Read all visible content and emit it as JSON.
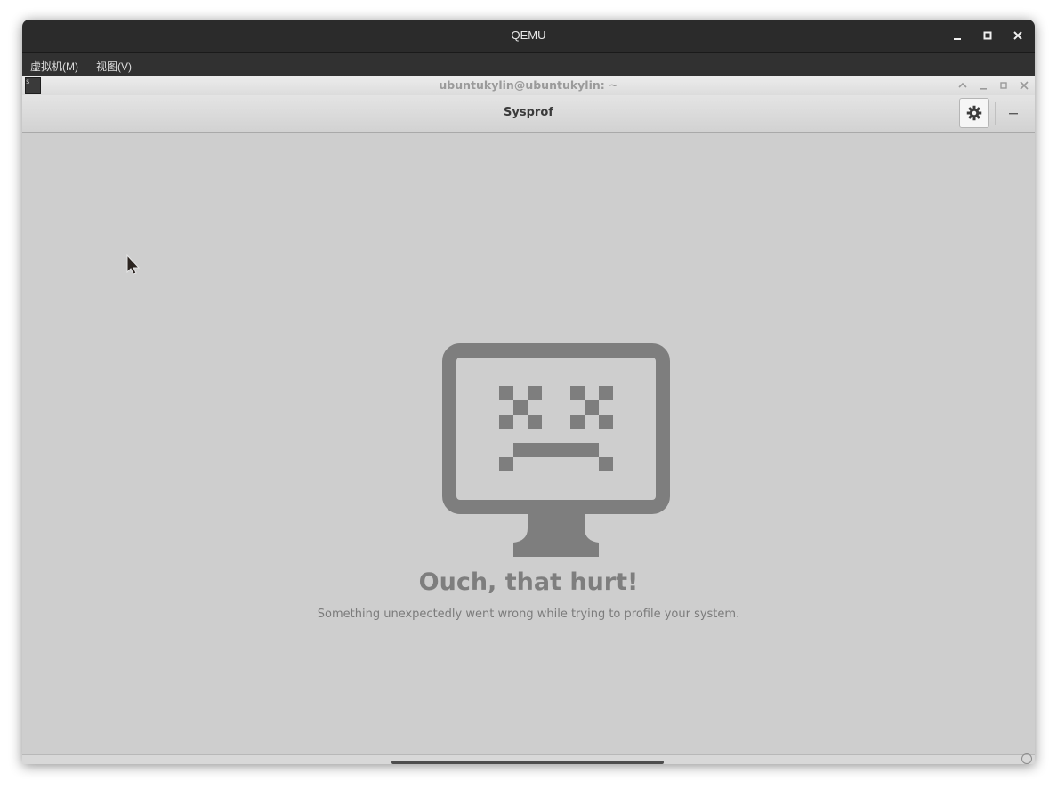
{
  "qemu": {
    "title": "QEMU",
    "menu": [
      "虚拟机(M)",
      "视图(V)"
    ],
    "controls": {
      "minimize_icon": "minimize-icon",
      "maximize_icon": "maximize-icon",
      "close_icon": "close-icon"
    }
  },
  "terminal": {
    "title": "ubuntukylin@ubuntukylin: ~",
    "icon_label": "$_"
  },
  "sysprof": {
    "title": "Sysprof",
    "settings_icon": "gear-icon",
    "minimize_icon": "minimize-icon"
  },
  "failure": {
    "icon": "sad-monitor-icon",
    "title": "Ouch, that hurt!",
    "subtitle": "Something unexpectedly went wrong while trying to profile your system."
  },
  "colors": {
    "qemu_titlebar": "#2b2b2b",
    "background": "#cecece",
    "icon": "#7e7e7e"
  }
}
